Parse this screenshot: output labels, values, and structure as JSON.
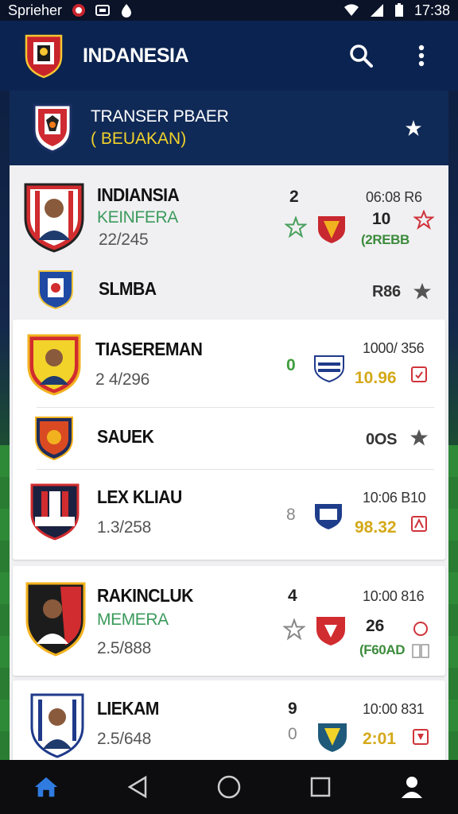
{
  "status_bar": {
    "carrier": "Sprieher",
    "time": "17:38"
  },
  "app_bar": {
    "title": "INDANESIA"
  },
  "sub_header": {
    "title": "TRANSER PBAER",
    "subtitle": "( BEUAKAN)"
  },
  "items": [
    {
      "name": "INDIANSIA",
      "role": "KEINFERA",
      "stat": "22/245",
      "number": "2",
      "fee": "06:08 R6",
      "value": "10",
      "tag": "(2REBB"
    },
    {
      "name": "SLMBA",
      "fee": "R86"
    },
    {
      "name": "TIASEREMAN",
      "stat": "2 4/296",
      "number": "0",
      "fee": "1000/ 356",
      "value": "10.96"
    },
    {
      "name": "SAUEK",
      "fee": "0OS"
    },
    {
      "name": "LEX KLIAU",
      "stat": "1.3/258",
      "number": "8",
      "fee": "10:06 B10",
      "value": "98.32"
    },
    {
      "name": "RAKINCLUK",
      "role": "MEMERA",
      "stat": "2.5/888",
      "number": "4",
      "fee": "10:00 816",
      "value": "26",
      "tag": "(F60AD"
    },
    {
      "name": "LIEKAM",
      "stat": "2.5/648",
      "number": "9",
      "fee": "10:00 831",
      "value": "2:01",
      "number2": "0"
    }
  ],
  "colors": {
    "app_bar": "#0b2350",
    "gold": "#d4a91a",
    "green": "#3c9a5c",
    "red": "#d0343b"
  }
}
